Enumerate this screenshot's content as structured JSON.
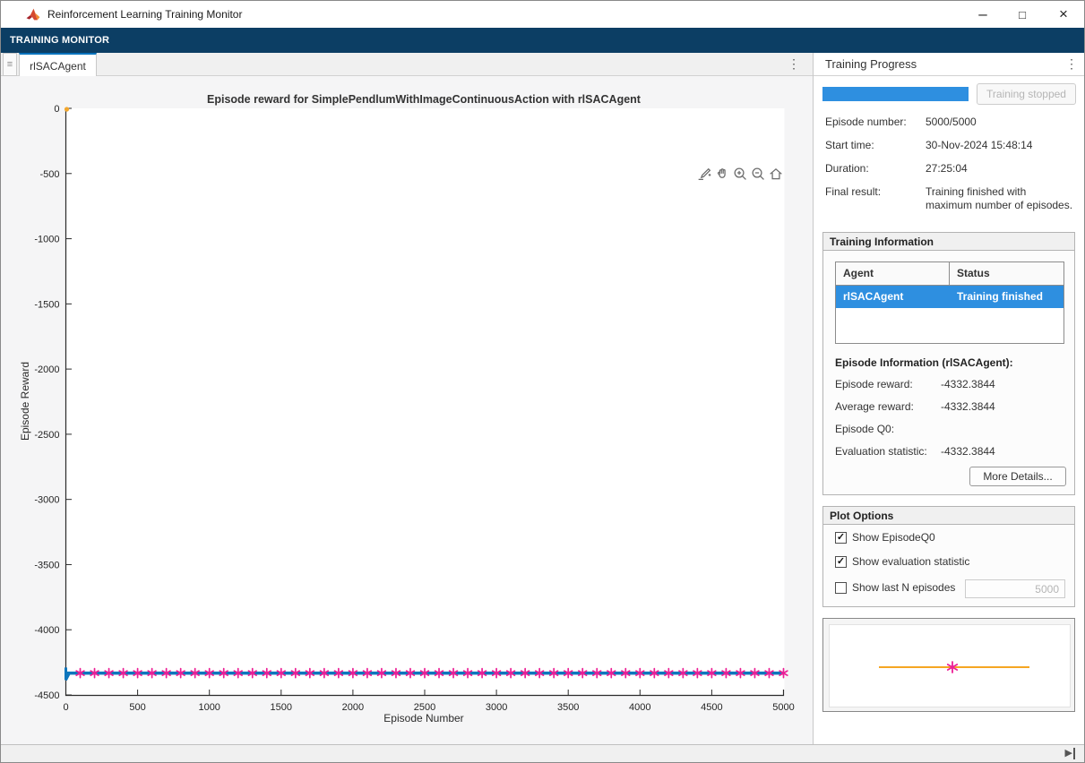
{
  "window": {
    "title": "Reinforcement Learning Training Monitor"
  },
  "icons": {
    "kebab": "⋮",
    "grip": "≡",
    "check": "✓",
    "minimize": "–",
    "maximize": "□",
    "close": "×",
    "advance": "▶"
  },
  "ribbon": {
    "label": "TRAINING MONITOR"
  },
  "tab_strip": {
    "tabs": [
      {
        "label": "rlSACAgent",
        "active": true
      }
    ]
  },
  "figure": {
    "toolbar_icons": [
      "brush-icon",
      "pan-hand-icon",
      "zoom-in-icon",
      "zoom-out-icon",
      "home-icon"
    ]
  },
  "chart_data": {
    "type": "line",
    "title": "Episode reward for SimplePendlumWithImageContinuousAction with rlSACAgent",
    "xlabel": "Episode Number",
    "ylabel": "Episode Reward",
    "xlim": [
      0,
      5000
    ],
    "ylim": [
      -4500,
      0
    ],
    "x_ticks": [
      0,
      500,
      1000,
      1500,
      2000,
      2500,
      3000,
      3500,
      4000,
      4500,
      5000
    ],
    "y_ticks": [
      0,
      -500,
      -1000,
      -1500,
      -2000,
      -2500,
      -3000,
      -3500,
      -4000,
      -4500
    ],
    "grid": false,
    "legend": "none",
    "series": [
      {
        "name": "Average reward",
        "type": "line",
        "color": "#0e76bd",
        "constant_y": -4332.3844,
        "x_start": 0,
        "x_end": 5000,
        "line_width": 3.5
      },
      {
        "name": "Episode reward",
        "type": "polyline",
        "color": "#0e76bd",
        "line_width": 3,
        "points": [
          [
            0,
            -4290
          ],
          [
            0,
            -4385
          ],
          [
            25,
            -4332.3844
          ],
          [
            5000,
            -4332.3844
          ]
        ]
      },
      {
        "name": "EpisodeQ0",
        "type": "point",
        "color": "#f2a72e",
        "points": [
          [
            0,
            0
          ]
        ]
      },
      {
        "name": "Evaluation statistic",
        "type": "asterisk-markers",
        "color": "#ec1e96",
        "constant_y": -4332.3844,
        "x_start": 100,
        "x_end": 5000,
        "x_interval": 100
      }
    ]
  },
  "training_progress": {
    "header": "Training Progress",
    "progress_percent": 100,
    "progress_color": "#2e8fe0",
    "stop_button_label": "Training stopped",
    "fields": [
      {
        "label": "Episode number:",
        "value": "5000/5000"
      },
      {
        "label": "Start time:",
        "value": "30-Nov-2024 15:48:14"
      },
      {
        "label": "Duration:",
        "value": "27:25:04"
      },
      {
        "label": "Final result:",
        "value": "Training finished with maximum number of episodes."
      }
    ]
  },
  "training_information": {
    "header": "Training Information",
    "table": {
      "columns": [
        "Agent",
        "Status"
      ],
      "rows": [
        {
          "cells": [
            "rlSACAgent",
            "Training finished"
          ],
          "selected": true
        }
      ]
    },
    "episode_info_heading": "Episode Information (rlSACAgent):",
    "fields": [
      {
        "label": "Episode reward:",
        "value": "-4332.3844"
      },
      {
        "label": "Average reward:",
        "value": "-4332.3844"
      },
      {
        "label": "Episode Q0:",
        "value": ""
      },
      {
        "label": "Evaluation statistic:",
        "value": "-4332.3844"
      }
    ],
    "more_details_label": "More Details..."
  },
  "plot_options": {
    "header": "Plot Options",
    "options": [
      {
        "label": "Show EpisodeQ0",
        "checked": true
      },
      {
        "label": "Show evaluation statistic",
        "checked": true
      },
      {
        "label": "Show last N episodes",
        "checked": false
      }
    ],
    "last_n_value": "5000"
  },
  "preview_plot": {
    "line_color": "#f5a623",
    "marker_color": "#ec1e96"
  }
}
